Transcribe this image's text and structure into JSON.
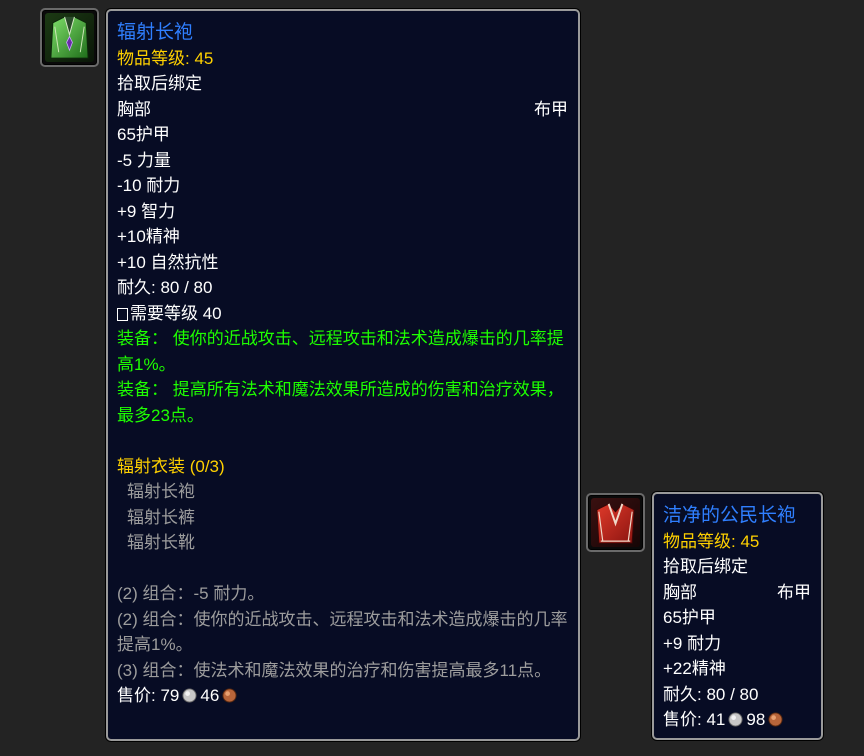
{
  "main_item": {
    "icon": "green-robe-icon",
    "name": "辐射长袍",
    "item_level": "物品等级: 45",
    "binding": "拾取后绑定",
    "slot": "胸部",
    "armor_type": "布甲",
    "armor": "65护甲",
    "stats": [
      "-5 力量",
      "-10 耐力",
      "+9 智力",
      "+10精神",
      "+10 自然抗性"
    ],
    "durability": "耐久: 80 / 80",
    "required_level": "需要等级 40",
    "equip_effects": [
      "装备： 使你的近战攻击、远程攻击和法术造成爆击的几率提高1%。",
      "装备： 提高所有法术和魔法效果所造成的伤害和治疗效果，最多23点。"
    ],
    "set_name": "辐射衣装 (0/3)",
    "set_pieces": [
      "辐射长袍",
      "辐射长裤",
      "辐射长靴"
    ],
    "set_bonuses": [
      "(2) 组合：-5 耐力。",
      "(2) 组合：使你的近战攻击、远程攻击和法术造成爆击的几率提高1%。",
      "(3) 组合：使法术和魔法效果的治疗和伤害提高最多11点。"
    ],
    "sell_label": "售价: ",
    "sell_silver": "79",
    "sell_copper": "46"
  },
  "compare_item": {
    "icon": "red-robe-icon",
    "name": "洁净的公民长袍",
    "item_level": "物品等级: 45",
    "binding": "拾取后绑定",
    "slot": "胸部",
    "armor_type": "布甲",
    "armor": "65护甲",
    "stats": [
      "+9 耐力",
      "+22精神"
    ],
    "durability": "耐久: 80 / 80",
    "sell_label": "售价: ",
    "sell_silver": "41",
    "sell_copper": "98"
  },
  "colors": {
    "item_name": "#2f7fff",
    "item_level": "#ffd100",
    "equip_effect": "#1eff00",
    "set_name": "#ffd100",
    "inactive": "#9d9d9d",
    "tooltip_bg": "#070c24"
  }
}
